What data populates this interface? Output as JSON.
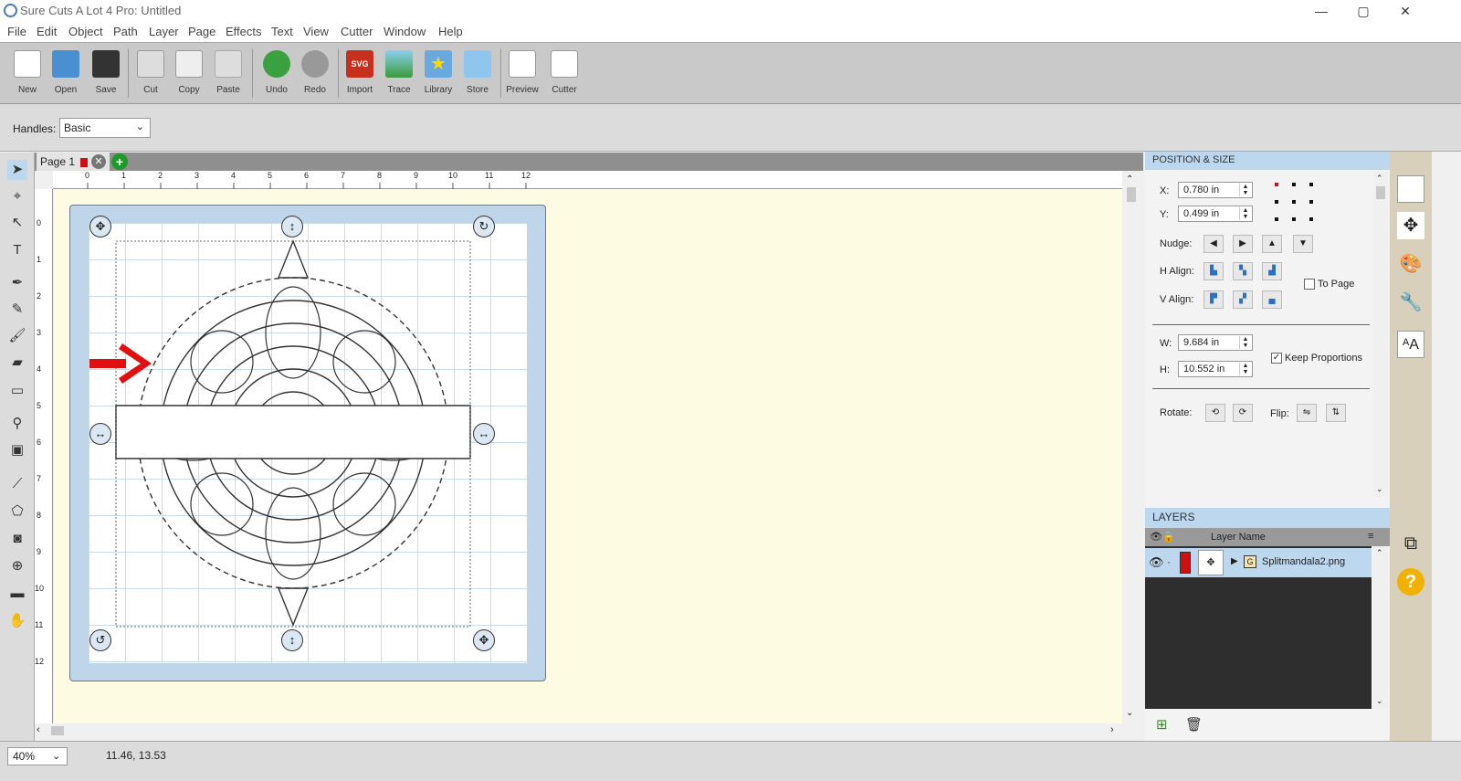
{
  "window": {
    "title": "Sure Cuts A Lot 4 Pro: Untitled",
    "minimize": "—",
    "maximize": "▢",
    "close": "✕"
  },
  "menu": [
    "File",
    "Edit",
    "Object",
    "Path",
    "Layer",
    "Page",
    "Effects",
    "Text",
    "View",
    "Cutter",
    "Window",
    "Help"
  ],
  "toolbar": {
    "new": "New",
    "open": "Open",
    "save": "Save",
    "cut": "Cut",
    "copy": "Copy",
    "paste": "Paste",
    "undo": "Undo",
    "redo": "Redo",
    "import": "Import",
    "trace": "Trace",
    "library": "Library",
    "store": "Store",
    "preview": "Preview",
    "cutter": "Cutter",
    "import_badge": "SVG"
  },
  "handles": {
    "label": "Handles:",
    "value": "Basic"
  },
  "page_tab": {
    "label": "Page 1"
  },
  "ruler_h": [
    "0",
    "1",
    "2",
    "3",
    "4",
    "5",
    "6",
    "7",
    "8",
    "9",
    "10",
    "11",
    "12"
  ],
  "ruler_v": [
    "0",
    "1",
    "2",
    "3",
    "4",
    "5",
    "6",
    "7",
    "8",
    "9",
    "10",
    "11",
    "12"
  ],
  "position_size": {
    "title": "POSITION & SIZE",
    "x_label": "X:",
    "x": "0.780 in",
    "y_label": "Y:",
    "y": "0.499 in",
    "nudge_label": "Nudge:",
    "halign_label": "H Align:",
    "valign_label": "V Align:",
    "to_page": "To Page",
    "w_label": "W:",
    "w": "9.684 in",
    "h_label": "H:",
    "h": "10.552 in",
    "keep_proportions": "Keep Proportions",
    "rotate_label": "Rotate:",
    "flip_label": "Flip:"
  },
  "layers": {
    "title": "LAYERS",
    "col_name": "Layer Name",
    "row_name": "Splitmandala2.png",
    "group_badge": "G"
  },
  "status": {
    "zoom": "40%",
    "coords": "11.46, 13.53"
  },
  "colors": {
    "accent": "#bcd7ee",
    "canvas": "#fefbe3",
    "mat": "#bfd5e9",
    "arrow": "#e01010",
    "layer_color": "#d01010"
  }
}
